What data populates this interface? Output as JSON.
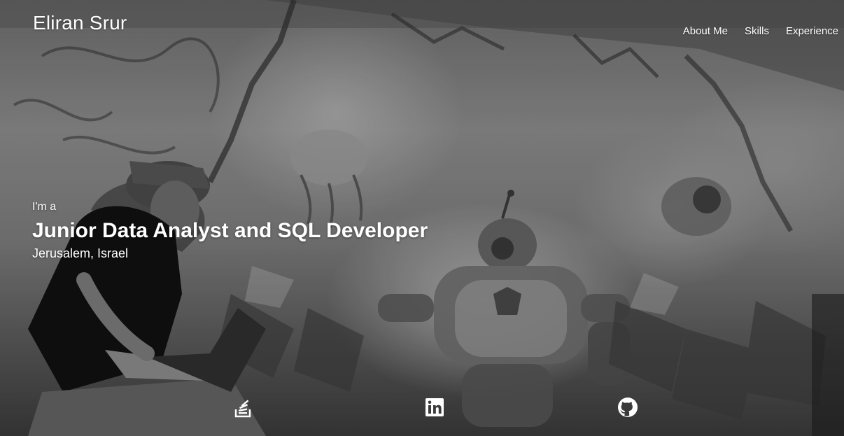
{
  "header": {
    "brand": "Eliran Srur",
    "nav": [
      {
        "label": "About Me"
      },
      {
        "label": "Skills"
      },
      {
        "label": "Experience"
      }
    ]
  },
  "hero": {
    "lead": "I'm a",
    "role": "Junior Data Analyst and SQL Developer",
    "location": "Jerusalem, Israel",
    "background": "grayscale graffiti wall photo with person using a laptop"
  },
  "socials": [
    {
      "icon": "stack-overflow-icon"
    },
    {
      "icon": "linkedin-icon"
    },
    {
      "icon": "github-icon"
    }
  ],
  "colors": {
    "text": "#ffffff",
    "background_tone": "#7a7a7a"
  }
}
